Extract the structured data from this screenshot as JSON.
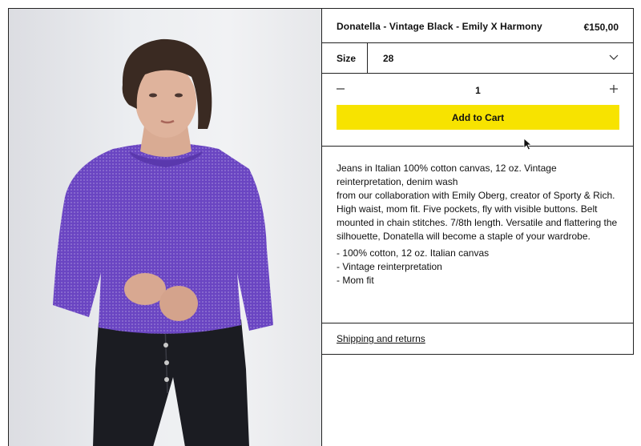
{
  "product": {
    "title": "Donatella - Vintage Black - Emily X Harmony",
    "price": "€150,00",
    "image_alt": "Model wearing purple sweater and black jeans"
  },
  "size": {
    "label": "Size",
    "selected": "28"
  },
  "quantity": {
    "value": "1"
  },
  "cart": {
    "button_label": "Add to Cart",
    "button_color": "#f7e300"
  },
  "description": {
    "paragraph_1": "Jeans in Italian 100% cotton canvas, 12 oz. Vintage reinterpretation, denim wash",
    "paragraph_2": "from our collaboration with Emily Oberg, creator of Sporty & Rich. High waist, mom fit. Five pockets, fly with visible buttons. Belt mounted in chain stitches. 7/8th length. Versatile and flattering the silhouette, Donatella will become a staple of your wardrobe.",
    "bullets": [
      "- 100% cotton, 12 oz. Italian canvas",
      "- Vintage reinterpretation",
      "- Mom fit"
    ]
  },
  "shipping": {
    "link_label": "Shipping and returns"
  },
  "icons": {
    "minus": "minus-icon",
    "plus": "plus-icon",
    "chevron": "chevron-down-icon",
    "cursor": "mouse-cursor-icon"
  }
}
